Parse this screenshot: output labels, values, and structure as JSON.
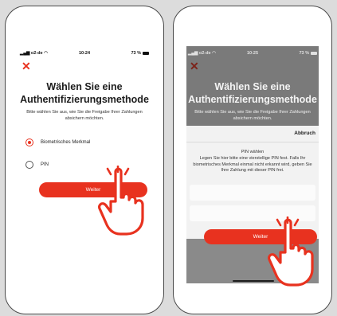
{
  "colors": {
    "accent": "#e8321f",
    "text": "#1d1d1d",
    "background": "#dcdcdc"
  },
  "left_screen": {
    "status": {
      "carrier": "o2-de",
      "time": "10:24",
      "battery": "73 %"
    },
    "close_icon": "close-icon",
    "title": "Wählen Sie eine Authentifizierungsmethode",
    "subtitle": "Bitte wählen Sie aus, wie Sie die Freigabe Ihrer Zahlungen absichern möchten.",
    "options": [
      {
        "label": "Biometrisches Merkmal",
        "selected": true
      },
      {
        "label": "PIN",
        "selected": false
      }
    ],
    "button_label": "Weiter"
  },
  "right_screen": {
    "status": {
      "carrier": "o2-de",
      "time": "10:25",
      "battery": "73 %"
    },
    "close_icon": "close-icon",
    "title": "Wählen Sie eine Authentifizierungsmethode",
    "subtitle": "Bitte wählen Sie aus, wie Sie die Freigabe Ihrer Zahlungen absichern möchten.",
    "sheet": {
      "cancel_label": "Abbruch",
      "pin_title": "PIN wählen",
      "pin_description": "Legen Sie hier bitte eine vierstellige PIN fest. Falls Ihr biometrisches Merkmal einmal nicht erkannt wird, geben Sie Ihre Zahlung mit dieser PIN frei."
    },
    "button_label": "Weiter"
  }
}
